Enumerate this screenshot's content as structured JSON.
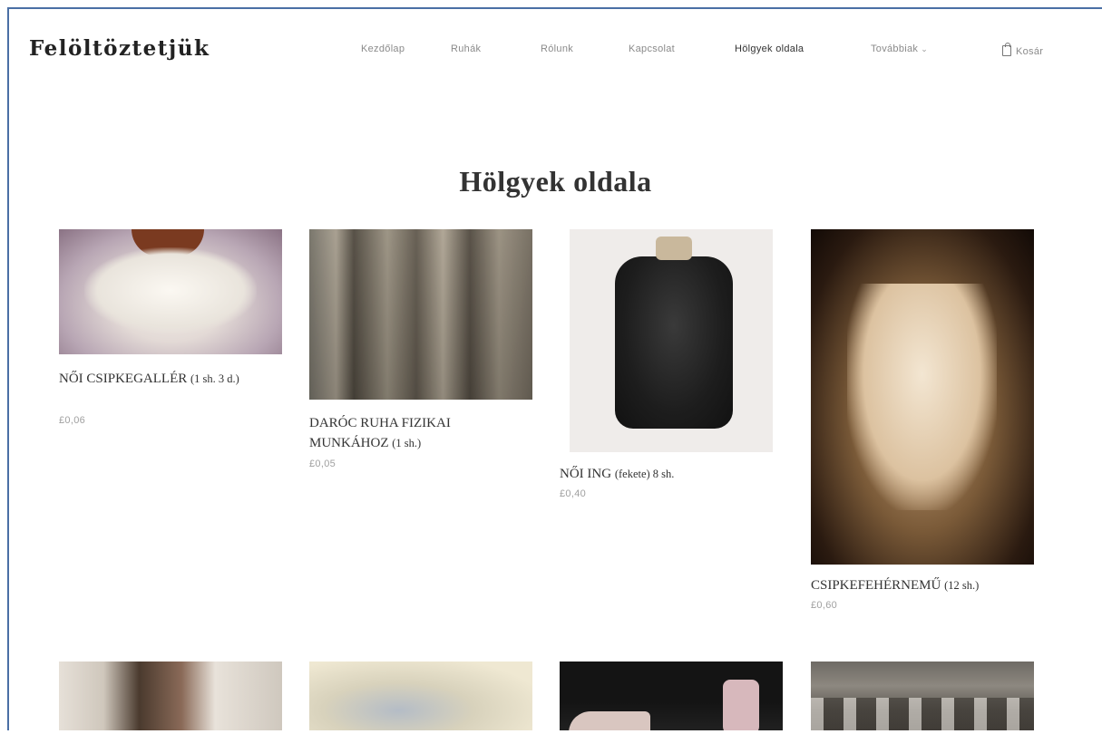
{
  "header": {
    "brand": "Felöltöztetjük",
    "nav": [
      {
        "label": "Kezdőlap",
        "active": false
      },
      {
        "label": "Ruhák",
        "active": false
      },
      {
        "label": "Rólunk",
        "active": false
      },
      {
        "label": "Kapcsolat",
        "active": false
      },
      {
        "label": "Hölgyek oldala",
        "active": true
      },
      {
        "label": "Továbbiak",
        "active": false
      }
    ],
    "cart_label": "Kosár"
  },
  "main": {
    "title": "Hölgyek oldala",
    "products": [
      {
        "name": "NŐI CSIPKEGALLÉR",
        "qty": "(1 sh. 3 d.)",
        "price": "£0,06",
        "image": "lace-collar"
      },
      {
        "name": "DARÓC RUHA FIZIKAI MUNKÁHOZ",
        "qty": "(1 sh.)",
        "price": "£0,05",
        "image": "working-women"
      },
      {
        "name": "NŐI ING",
        "qty": "(fekete) 8 sh.",
        "price": "£0,40",
        "image": "black-blouse"
      },
      {
        "name": "CSIPKEFEHÉRNEMŰ",
        "qty": "(12 sh.)",
        "price": "£0,60",
        "image": "lace-corset"
      },
      {
        "name": "",
        "qty": "",
        "price": "",
        "image": "edwardian-ladies"
      },
      {
        "name": "",
        "qty": "",
        "price": "",
        "image": "floral-illustration"
      },
      {
        "name": "",
        "qty": "",
        "price": "",
        "image": "ballet-shoes"
      },
      {
        "name": "",
        "qty": "",
        "price": "",
        "image": "group-portrait"
      }
    ]
  },
  "colors": {
    "frame_border": "#4a6fa5",
    "nav_inactive": "#8a8a8a",
    "nav_active": "#333333",
    "price": "#a0a0a0"
  }
}
